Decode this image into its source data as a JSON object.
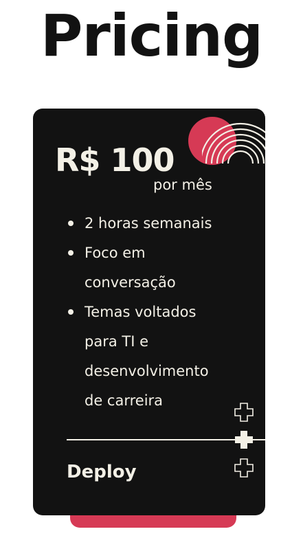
{
  "page": {
    "title": "Pricing"
  },
  "plan": {
    "price": "R$ 100",
    "period": "por mês",
    "features": [
      "2 horas semanais",
      "Foco em conversação",
      "Temas voltados para TI e desenvolvimento de carreira"
    ],
    "cta_label": "Deploy"
  },
  "colors": {
    "card_background": "#121212",
    "accent": "#d63a55",
    "card_text": "#f3f0e6",
    "title_text": "#121212"
  },
  "icons": [
    "signal-arcs-icon",
    "plus-outline-icon",
    "plus-filled-icon"
  ]
}
